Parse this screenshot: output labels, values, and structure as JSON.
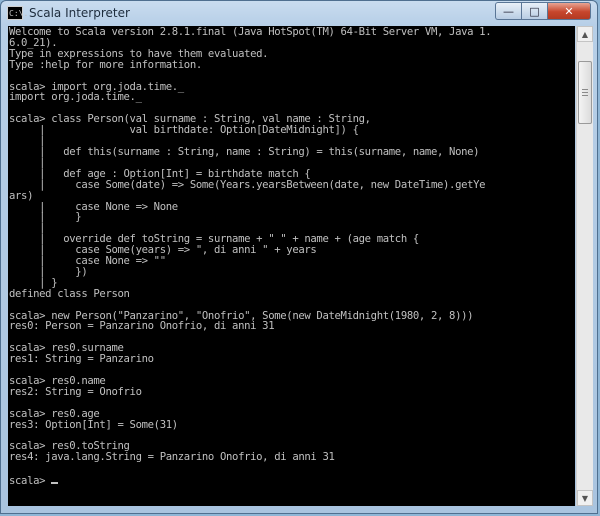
{
  "window": {
    "title": "Scala Interpreter",
    "app_icon_text": "C:\\.",
    "controls": {
      "minimize": "—",
      "maximize": "□",
      "close": "✕"
    },
    "icons": {
      "app": "console-app-icon",
      "scroll_up": "arrow-up-icon",
      "scroll_down": "arrow-down-icon"
    }
  },
  "console": {
    "lines": [
      "Welcome to Scala version 2.8.1.final (Java HotSpot(TM) 64-Bit Server VM, Java 1.",
      "6.0_21).",
      "Type in expressions to have them evaluated.",
      "Type :help for more information.",
      "",
      "scala> import org.joda.time._",
      "import org.joda.time._",
      "",
      "scala> class Person(val surname : String, val name : String,",
      "     |              val birthdate: Option[DateMidnight]) {",
      "     |",
      "     |   def this(surname : String, name : String) = this(surname, name, None)",
      "     |",
      "     |   def age : Option[Int] = birthdate match {",
      "     |     case Some(date) => Some(Years.yearsBetween(date, new DateTime).getYe",
      "ars)",
      "     |     case None => None",
      "     |     }",
      "     |",
      "     |   override def toString = surname + \" \" + name + (age match {",
      "     |     case Some(years) => \", di anni \" + years",
      "     |     case None => \"\"",
      "     |     })",
      "     | }",
      "defined class Person",
      "",
      "scala> new Person(\"Panzarino\", \"Onofrio\", Some(new DateMidnight(1980, 2, 8)))",
      "res0: Person = Panzarino Onofrio, di anni 31",
      "",
      "scala> res0.surname",
      "res1: String = Panzarino",
      "",
      "scala> res0.name",
      "res2: String = Onofrio",
      "",
      "scala> res0.age",
      "res3: Option[Int] = Some(31)",
      "",
      "scala> res0.toString",
      "res4: java.lang.String = Panzarino Onofrio, di anni 31",
      ""
    ],
    "prompt": "scala> "
  }
}
